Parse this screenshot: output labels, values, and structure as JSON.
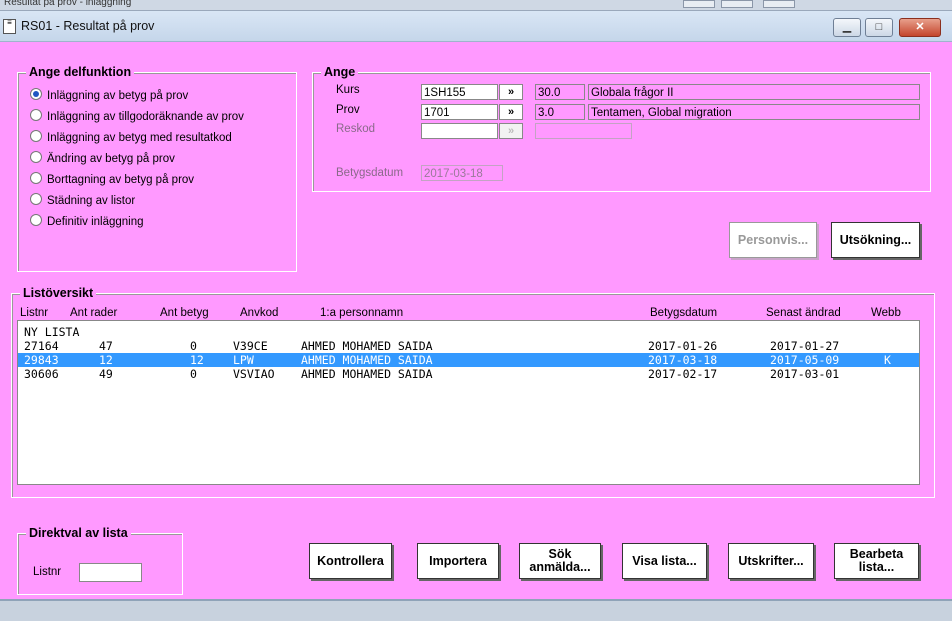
{
  "window": {
    "title": "RS01 - Resultat på prov"
  },
  "partial_top": {
    "label": "Resultat på prov - inläggning"
  },
  "delfunktion": {
    "legend": "Ange delfunktion",
    "options": [
      {
        "label": "Inläggning av betyg på prov",
        "selected": true
      },
      {
        "label": "Inläggning av tillgodoräknande av prov",
        "selected": false
      },
      {
        "label": "Inläggning av betyg med resultatkod",
        "selected": false
      },
      {
        "label": "Ändring av betyg på prov",
        "selected": false
      },
      {
        "label": "Borttagning av betyg på prov",
        "selected": false
      },
      {
        "label": "Städning av listor",
        "selected": false
      },
      {
        "label": "Definitiv inläggning",
        "selected": false
      }
    ]
  },
  "ange": {
    "legend": "Ange",
    "kurs": {
      "label": "Kurs",
      "code": "1SH155",
      "btn": "»",
      "points": "30.0",
      "name": "Globala frågor II"
    },
    "prov": {
      "label": "Prov",
      "code": "1701",
      "btn": "»",
      "points": "3.0",
      "name": "Tentamen, Global migration"
    },
    "reskod": {
      "label": "Reskod",
      "code": "",
      "btn": "»",
      "points": ""
    },
    "betygsdatum": {
      "label": "Betygsdatum",
      "value": "2017-03-18"
    }
  },
  "buttons": {
    "personvis": "Personvis...",
    "utsokning": "Utsökning...",
    "kontrollera": "Kontrollera",
    "importera": "Importera",
    "sok_anmalda_1": "Sök",
    "sok_anmalda_2": "anmälda...",
    "visa_lista": "Visa lista...",
    "utskrifter": "Utskrifter...",
    "bearbeta_1": "Bearbeta",
    "bearbeta_2": "lista..."
  },
  "listoversikt": {
    "legend": "Listöversikt",
    "columns": {
      "listnr": "Listnr",
      "ant_rader": "Ant rader",
      "ant_betyg": "Ant betyg",
      "anvkod": "Anvkod",
      "personnamn": "1:a personnamn",
      "betygsdatum": "Betygsdatum",
      "senast_andrad": "Senast ändrad",
      "webb": "Webb"
    },
    "header_row": "NY LISTA",
    "rows": [
      {
        "listnr": "27164",
        "ant_rader": "47",
        "ant_betyg": "0",
        "anvkod": "V39CE",
        "personnamn": "AHMED MOHAMED SAIDA",
        "betygsdatum": "2017-01-26",
        "senast_andrad": "2017-01-27",
        "webb": "",
        "selected": false
      },
      {
        "listnr": "29843",
        "ant_rader": "12",
        "ant_betyg": "12",
        "anvkod": "LPW",
        "personnamn": "AHMED MOHAMED SAIDA",
        "betygsdatum": "2017-03-18",
        "senast_andrad": "2017-05-09",
        "webb": "K",
        "selected": true
      },
      {
        "listnr": "30606",
        "ant_rader": "49",
        "ant_betyg": "0",
        "anvkod": "VSVIAO",
        "personnamn": "AHMED MOHAMED SAIDA",
        "betygsdatum": "2017-02-17",
        "senast_andrad": "2017-03-01",
        "webb": "",
        "selected": false
      }
    ]
  },
  "direktval": {
    "legend": "Direktval av lista",
    "listnr_label": "Listnr",
    "listnr_value": ""
  }
}
